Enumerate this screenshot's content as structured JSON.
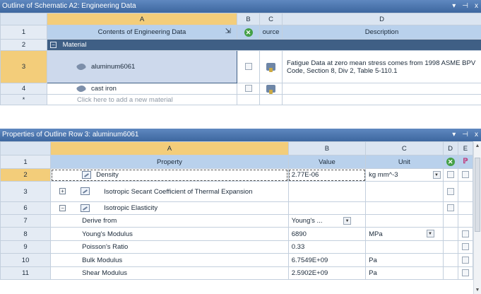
{
  "outline": {
    "title": "Outline of Schematic A2: Engineering Data",
    "controls": [
      "▾",
      "⊣",
      "x"
    ],
    "col_letters": [
      "A",
      "B",
      "C",
      "D"
    ],
    "header": {
      "row": "1",
      "contents": "Contents of Engineering Data",
      "source": "ource",
      "description": "Description"
    },
    "group": {
      "row": "2",
      "label": "Material",
      "toggle": "−"
    },
    "materials": [
      {
        "row": "3",
        "name": "aluminum6061",
        "description": "Fatigue Data at zero mean stress comes from 1998 ASME BPV Code, Section 8, Div 2, Table 5-110.1"
      },
      {
        "row": "4",
        "name": "cast iron",
        "description": ""
      }
    ],
    "add_row": {
      "row": "*",
      "label": "Click here to add a new material"
    }
  },
  "properties": {
    "title": "Properties of Outline Row 3: aluminum6061",
    "controls": [
      "▾",
      "⊣",
      "x"
    ],
    "col_letters": [
      "A",
      "B",
      "C",
      "D",
      "E"
    ],
    "header": {
      "row": "1",
      "property": "Property",
      "value": "Value",
      "unit": "Unit"
    },
    "rows": [
      {
        "row": "2",
        "property": "Density",
        "value": "2.77E-06",
        "unit": "kg mm^-3"
      },
      {
        "row": "3",
        "property": "Isotropic Secant Coefficient of Thermal Expansion",
        "value": "",
        "unit": "",
        "toggle": "+"
      },
      {
        "row": "6",
        "property": "Isotropic Elasticity",
        "value": "",
        "unit": "",
        "toggle": "−"
      },
      {
        "row": "7",
        "property": "Derive from",
        "value": "Young's ...",
        "unit": ""
      },
      {
        "row": "8",
        "property": "Young's Modulus",
        "value": "6890",
        "unit": "MPa"
      },
      {
        "row": "9",
        "property": "Poisson's Ratio",
        "value": "0.33",
        "unit": ""
      },
      {
        "row": "10",
        "property": "Bulk Modulus",
        "value": "6.7549E+09",
        "unit": "Pa"
      },
      {
        "row": "11",
        "property": "Shear Modulus",
        "value": "2.5902E+09",
        "unit": "Pa"
      }
    ]
  },
  "colors": {
    "title_bar": "#3d679f",
    "header_fill": "#b9d1ec",
    "group_fill": "#3f5f85",
    "selected_col": "#f3cd7a"
  }
}
